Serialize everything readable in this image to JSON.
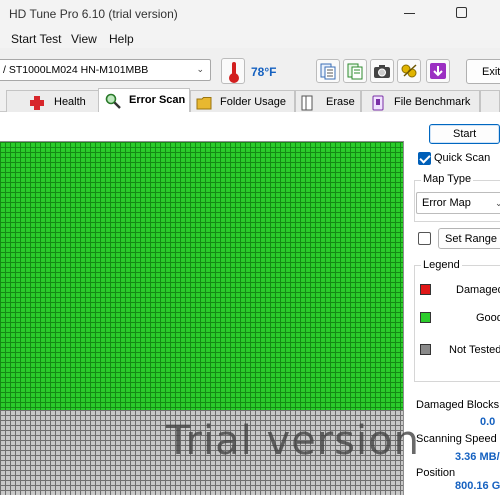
{
  "window": {
    "title": "HD Tune Pro 6.10 (trial version)"
  },
  "menu": {
    "items": [
      "Start Test",
      "View",
      "Help"
    ]
  },
  "toolbar": {
    "drive": "/ ST1000LM024 HN-M101MBB",
    "temperature": "78°F",
    "exit_label": "Exit",
    "icons": [
      "copy-text-icon",
      "copy-info-icon",
      "screenshot-icon",
      "options-icon",
      "save-download-icon"
    ]
  },
  "tabs": [
    {
      "label": "Health",
      "icon": "health-cross-icon",
      "active": false
    },
    {
      "label": "Error Scan",
      "icon": "magnifier-icon",
      "active": true
    },
    {
      "label": "Folder Usage",
      "icon": "folder-icon",
      "active": false
    },
    {
      "label": "Erase",
      "icon": "erase-icon",
      "active": false
    },
    {
      "label": "File Benchmark",
      "icon": "file-benchmark-icon",
      "active": false
    }
  ],
  "scan": {
    "start_label": "Start",
    "quick_scan_label": "Quick Scan",
    "quick_scan_checked": true,
    "map_type_label": "Map Type",
    "map_type_value": "Error Map",
    "set_range_checked": false,
    "set_range_label": "Set Range",
    "progress_fraction": 0.76,
    "watermark": "Trial version"
  },
  "legend": {
    "title": "Legend",
    "items": [
      {
        "label": "Damaged",
        "color": "#e01818"
      },
      {
        "label": "Good",
        "color": "#2bcc2b"
      },
      {
        "label": "Not Tested",
        "color": "#8a8a8a"
      }
    ]
  },
  "stats": {
    "damaged_blocks_label": "Damaged Blocks",
    "damaged_blocks_value": "0.0",
    "scanning_speed_label": "Scanning Speed",
    "scanning_speed_value": "3.36 MB/",
    "position_label": "Position",
    "position_value": "800.16 G"
  }
}
